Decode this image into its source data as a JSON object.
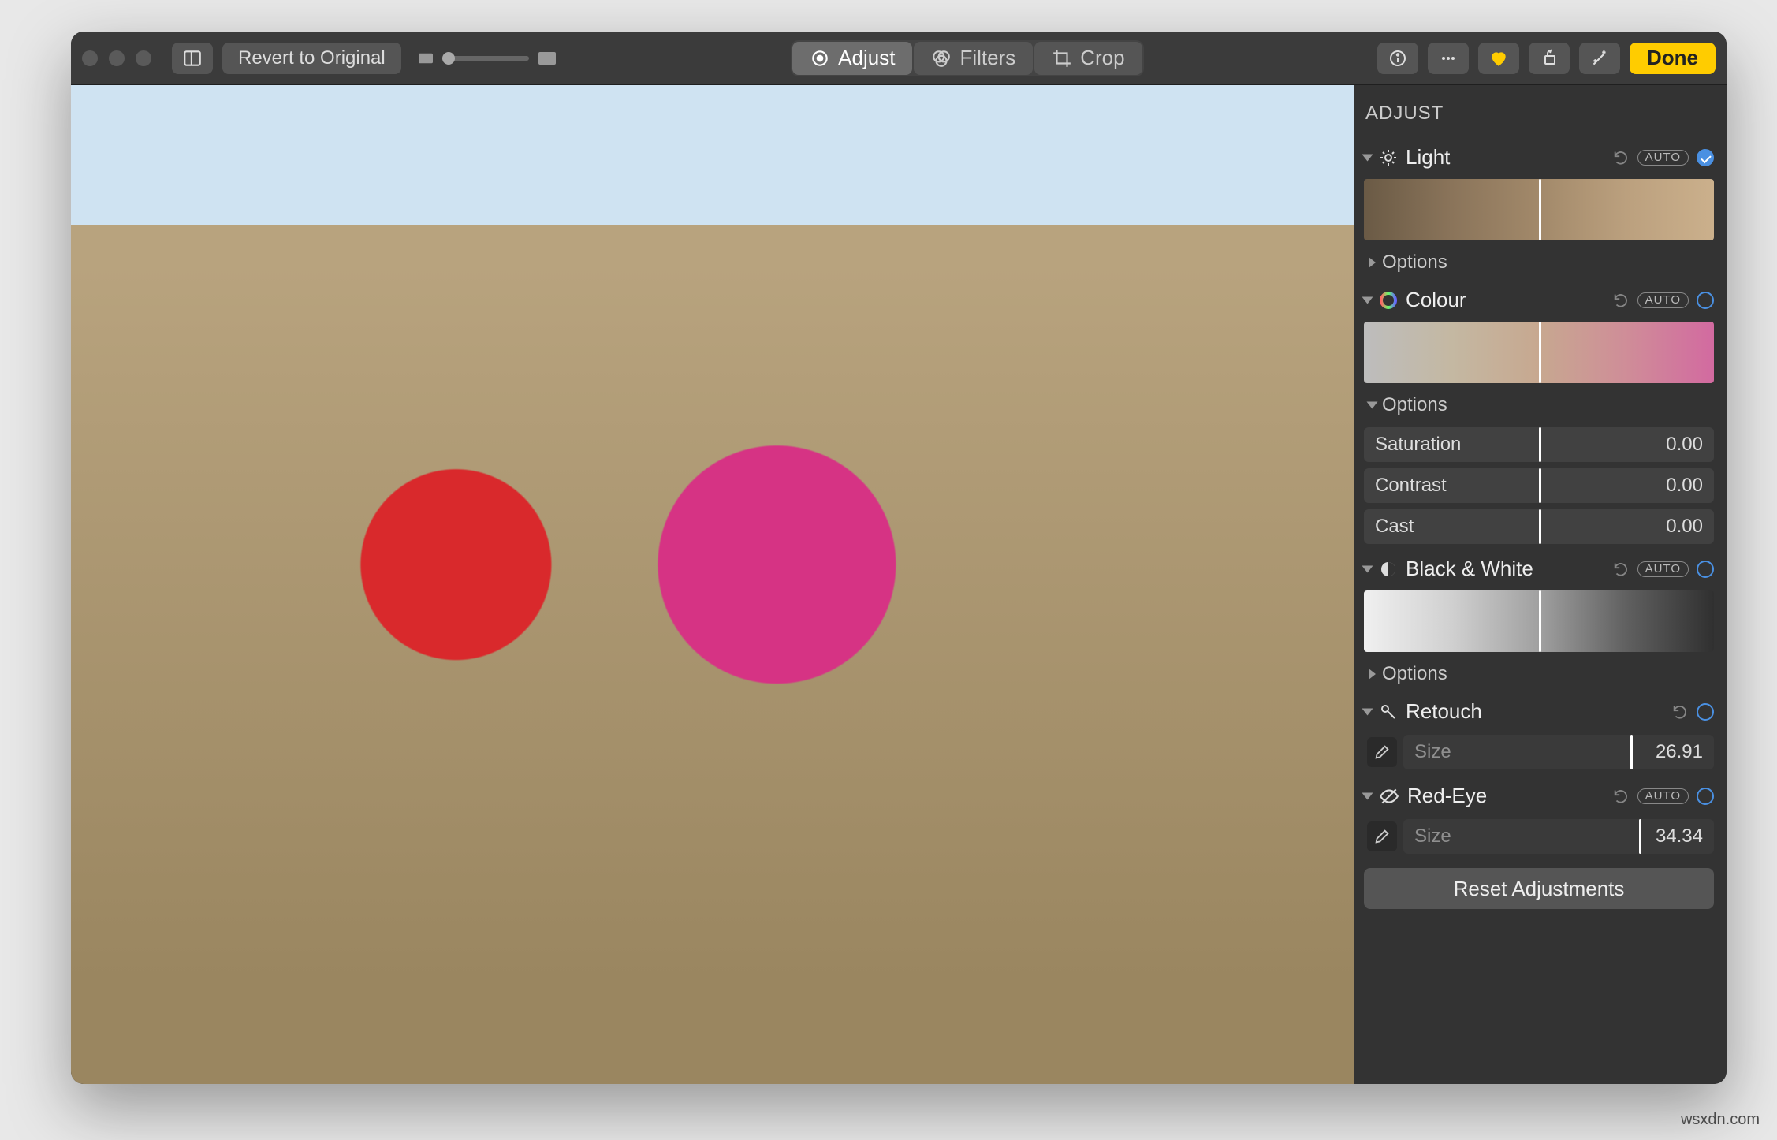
{
  "toolbar": {
    "revert_label": "Revert to Original",
    "tabs": {
      "adjust": "Adjust",
      "filters": "Filters",
      "crop": "Crop"
    },
    "done_label": "Done"
  },
  "sidebar": {
    "title": "ADJUST",
    "light": {
      "label": "Light",
      "options_label": "Options",
      "auto": "AUTO"
    },
    "colour": {
      "label": "Colour",
      "options_label": "Options",
      "auto": "AUTO",
      "sliders": {
        "saturation": {
          "label": "Saturation",
          "value": "0.00"
        },
        "contrast": {
          "label": "Contrast",
          "value": "0.00"
        },
        "cast": {
          "label": "Cast",
          "value": "0.00"
        }
      }
    },
    "bw": {
      "label": "Black & White",
      "options_label": "Options",
      "auto": "AUTO"
    },
    "retouch": {
      "label": "Retouch",
      "size_label": "Size",
      "size_value": "26.91"
    },
    "redeye": {
      "label": "Red-Eye",
      "auto": "AUTO",
      "size_label": "Size",
      "size_value": "34.34"
    },
    "reset_label": "Reset Adjustments"
  },
  "watermark": "wsxdn.com"
}
